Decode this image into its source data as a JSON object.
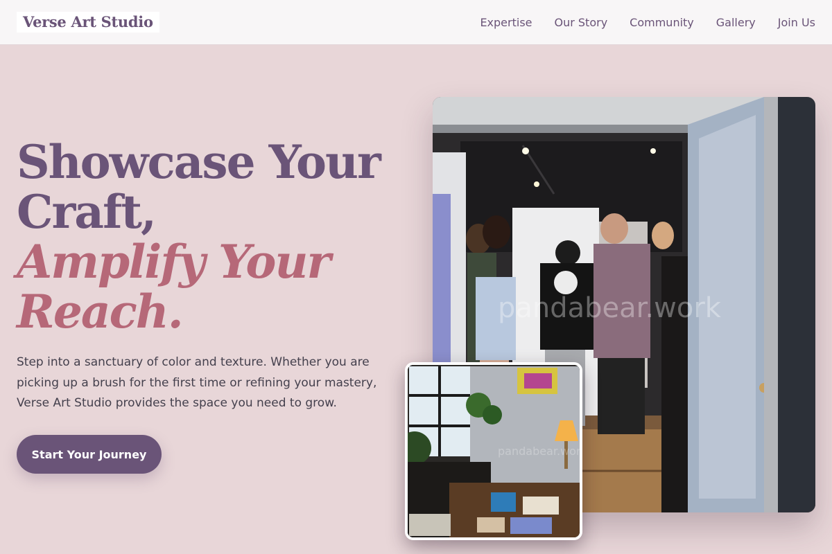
{
  "brand": {
    "name": "Verse Art Studio"
  },
  "nav": {
    "items": [
      {
        "label": "Expertise"
      },
      {
        "label": "Our Story"
      },
      {
        "label": "Community"
      },
      {
        "label": "Gallery"
      },
      {
        "label": "Join Us"
      }
    ]
  },
  "hero": {
    "title_line1": "Showcase Your",
    "title_line2": "Craft,",
    "title_accent_line1": "Amplify Your",
    "title_accent_line2": "Reach.",
    "description": "Step into a sanctuary of color and texture. Whether you are picking up a brush for the first time or refining your mastery, Verse Art Studio provides the space you need to grow.",
    "cta_label": "Start Your Journey"
  },
  "images": {
    "main_watermark": "pandabear.work",
    "small_watermark": "pandabear.work"
  },
  "colors": {
    "background": "#e8d6d8",
    "primary": "#6a5478",
    "accent": "#b66878",
    "text": "#44404d"
  }
}
